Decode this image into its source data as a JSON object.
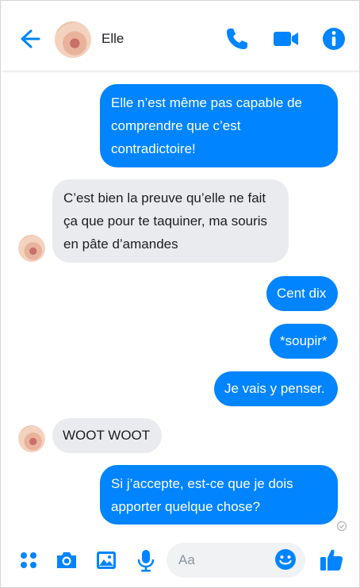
{
  "header": {
    "contact_name": "Elle",
    "accent_color": "#0084ff"
  },
  "messages": [
    {
      "from": "me",
      "text": "Elle n’est même pas capable de\ncomprendre que c’est\ncontradictoire!"
    },
    {
      "from": "them",
      "text": "C’est bien la preuve qu’elle ne fait\nça que pour te taquiner, ma souris\nen pâte d’amandes"
    },
    {
      "from": "me",
      "text": "Cent dix"
    },
    {
      "from": "me",
      "text": "*soupir*"
    },
    {
      "from": "me",
      "text": "Je vais y penser."
    },
    {
      "from": "them",
      "text": "WOOT WOOT"
    },
    {
      "from": "me",
      "text": "Si j’accepte, est-ce que je dois\napporter quelque chose?"
    }
  ],
  "composer": {
    "placeholder": "Aa"
  },
  "icons": [
    "back-arrow-icon",
    "phone-icon",
    "video-camera-icon",
    "info-icon",
    "menu-dots-icon",
    "camera-icon",
    "photo-icon",
    "microphone-icon",
    "emoji-icon",
    "thumbs-up-icon",
    "read-receipt-icon"
  ]
}
